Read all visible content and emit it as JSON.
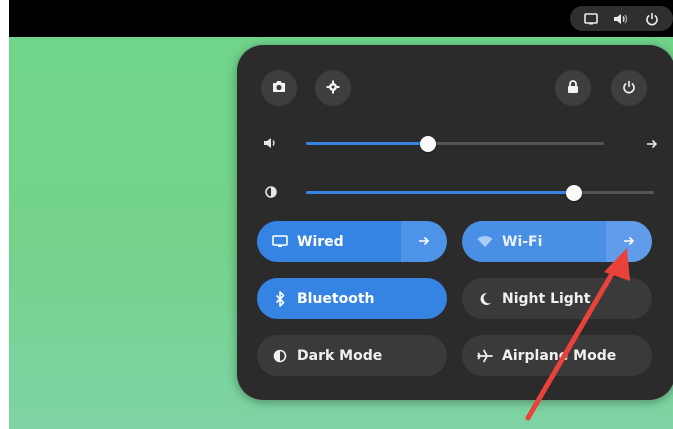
{
  "colors": {
    "accent": "#3584e4",
    "panel": "#2b2b2b",
    "desktop": "#6fd58a",
    "annotation_arrow": "#e8423a"
  },
  "topbar": {
    "tray_icons": [
      "display-icon",
      "speaker-icon",
      "power-icon"
    ]
  },
  "quick_settings": {
    "header_buttons": {
      "screenshot": "camera-icon",
      "settings": "gear-icon",
      "lock": "lock-icon",
      "power": "power-icon"
    },
    "volume": {
      "level": 0.41,
      "icon": "speaker-icon"
    },
    "brightness": {
      "level": 0.77,
      "icon": "brightness-icon"
    },
    "tiles": {
      "wired": {
        "label": "Wired",
        "state": "on"
      },
      "wifi": {
        "label": "Wi-Fi",
        "state": "on"
      },
      "bluetooth": {
        "label": "Bluetooth",
        "state": "on"
      },
      "night_light": {
        "label": "Night Light",
        "state": "off"
      },
      "dark_mode": {
        "label": "Dark Mode",
        "state": "off"
      },
      "airplane_mode": {
        "label": "Airplane Mode",
        "state": "off"
      }
    }
  }
}
